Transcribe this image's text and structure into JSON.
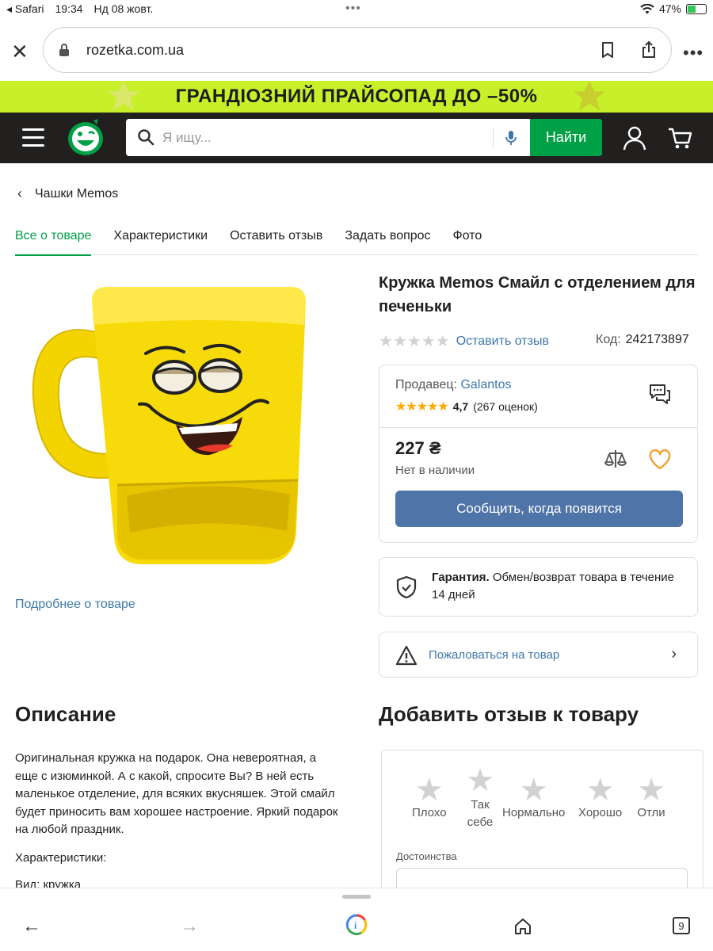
{
  "status_bar": {
    "back_app": "Safari",
    "time": "19:34",
    "date": "Нд 08 жовт.",
    "battery": "47%",
    "battery_level": 0.47
  },
  "browser": {
    "url": "rozetka.com.ua"
  },
  "promo": {
    "text": "ГРАНДІОЗНИЙ ПРАЙСОПАД ДО –50%"
  },
  "header": {
    "search_placeholder": "Я ищу...",
    "search_button": "Найти"
  },
  "breadcrumb": {
    "label": "Чашки Memos"
  },
  "tabs": [
    {
      "label": "Все о товаре",
      "active": true
    },
    {
      "label": "Характеристики",
      "active": false
    },
    {
      "label": "Оставить отзыв",
      "active": false
    },
    {
      "label": "Задать вопрос",
      "active": false
    },
    {
      "label": "Фото",
      "active": false
    }
  ],
  "product": {
    "title": "Кружка Memos Смайл с отделением для печеньки",
    "leave_review": "Оставить отзыв",
    "code_label": "Код:",
    "code": "242173897",
    "more_link": "Подробнее о товаре",
    "rating_stars_filled": 0
  },
  "seller": {
    "label": "Продавец:",
    "name": "Galantos",
    "rating": "4,7",
    "ratings_count": "(267 оценок)",
    "price": "227 ₴",
    "availability": "Нет в наличии",
    "notify_button": "Сообщить, когда появится"
  },
  "guarantee": {
    "title": "Гарантия.",
    "text": "Обмен/возврат товара в течение 14 дней"
  },
  "complaint": {
    "text": "Пожаловаться на товар"
  },
  "description": {
    "heading": "Описание",
    "text": "Оригинальная кружка на подарок. Она невероятная, а еще с изюминкой. А с какой, спросите Вы? В ней есть маленькое отделение, для всяких вкусняшек. Этой смайл будет приносить вам хорошее настроение. Яркий подарок на любой праздник.",
    "chars_label": "Характеристики:",
    "partial_line": "Вид: кружка"
  },
  "review": {
    "heading": "Добавить отзыв к товару",
    "options": [
      "Плохо",
      "Так себе",
      "Нормально",
      "Хорошо",
      "Отли"
    ],
    "merits_label": "Достоинства"
  },
  "bottom_bar": {
    "tabs_count": "9"
  },
  "colors": {
    "brand_green": "#00a046",
    "header_dark": "#221f1f",
    "promo_lime": "#c7f02a",
    "link_blue": "#3e77aa",
    "button_blue": "#4f74a8",
    "star_orange": "#ffa900",
    "heart_orange": "#f0a030"
  }
}
